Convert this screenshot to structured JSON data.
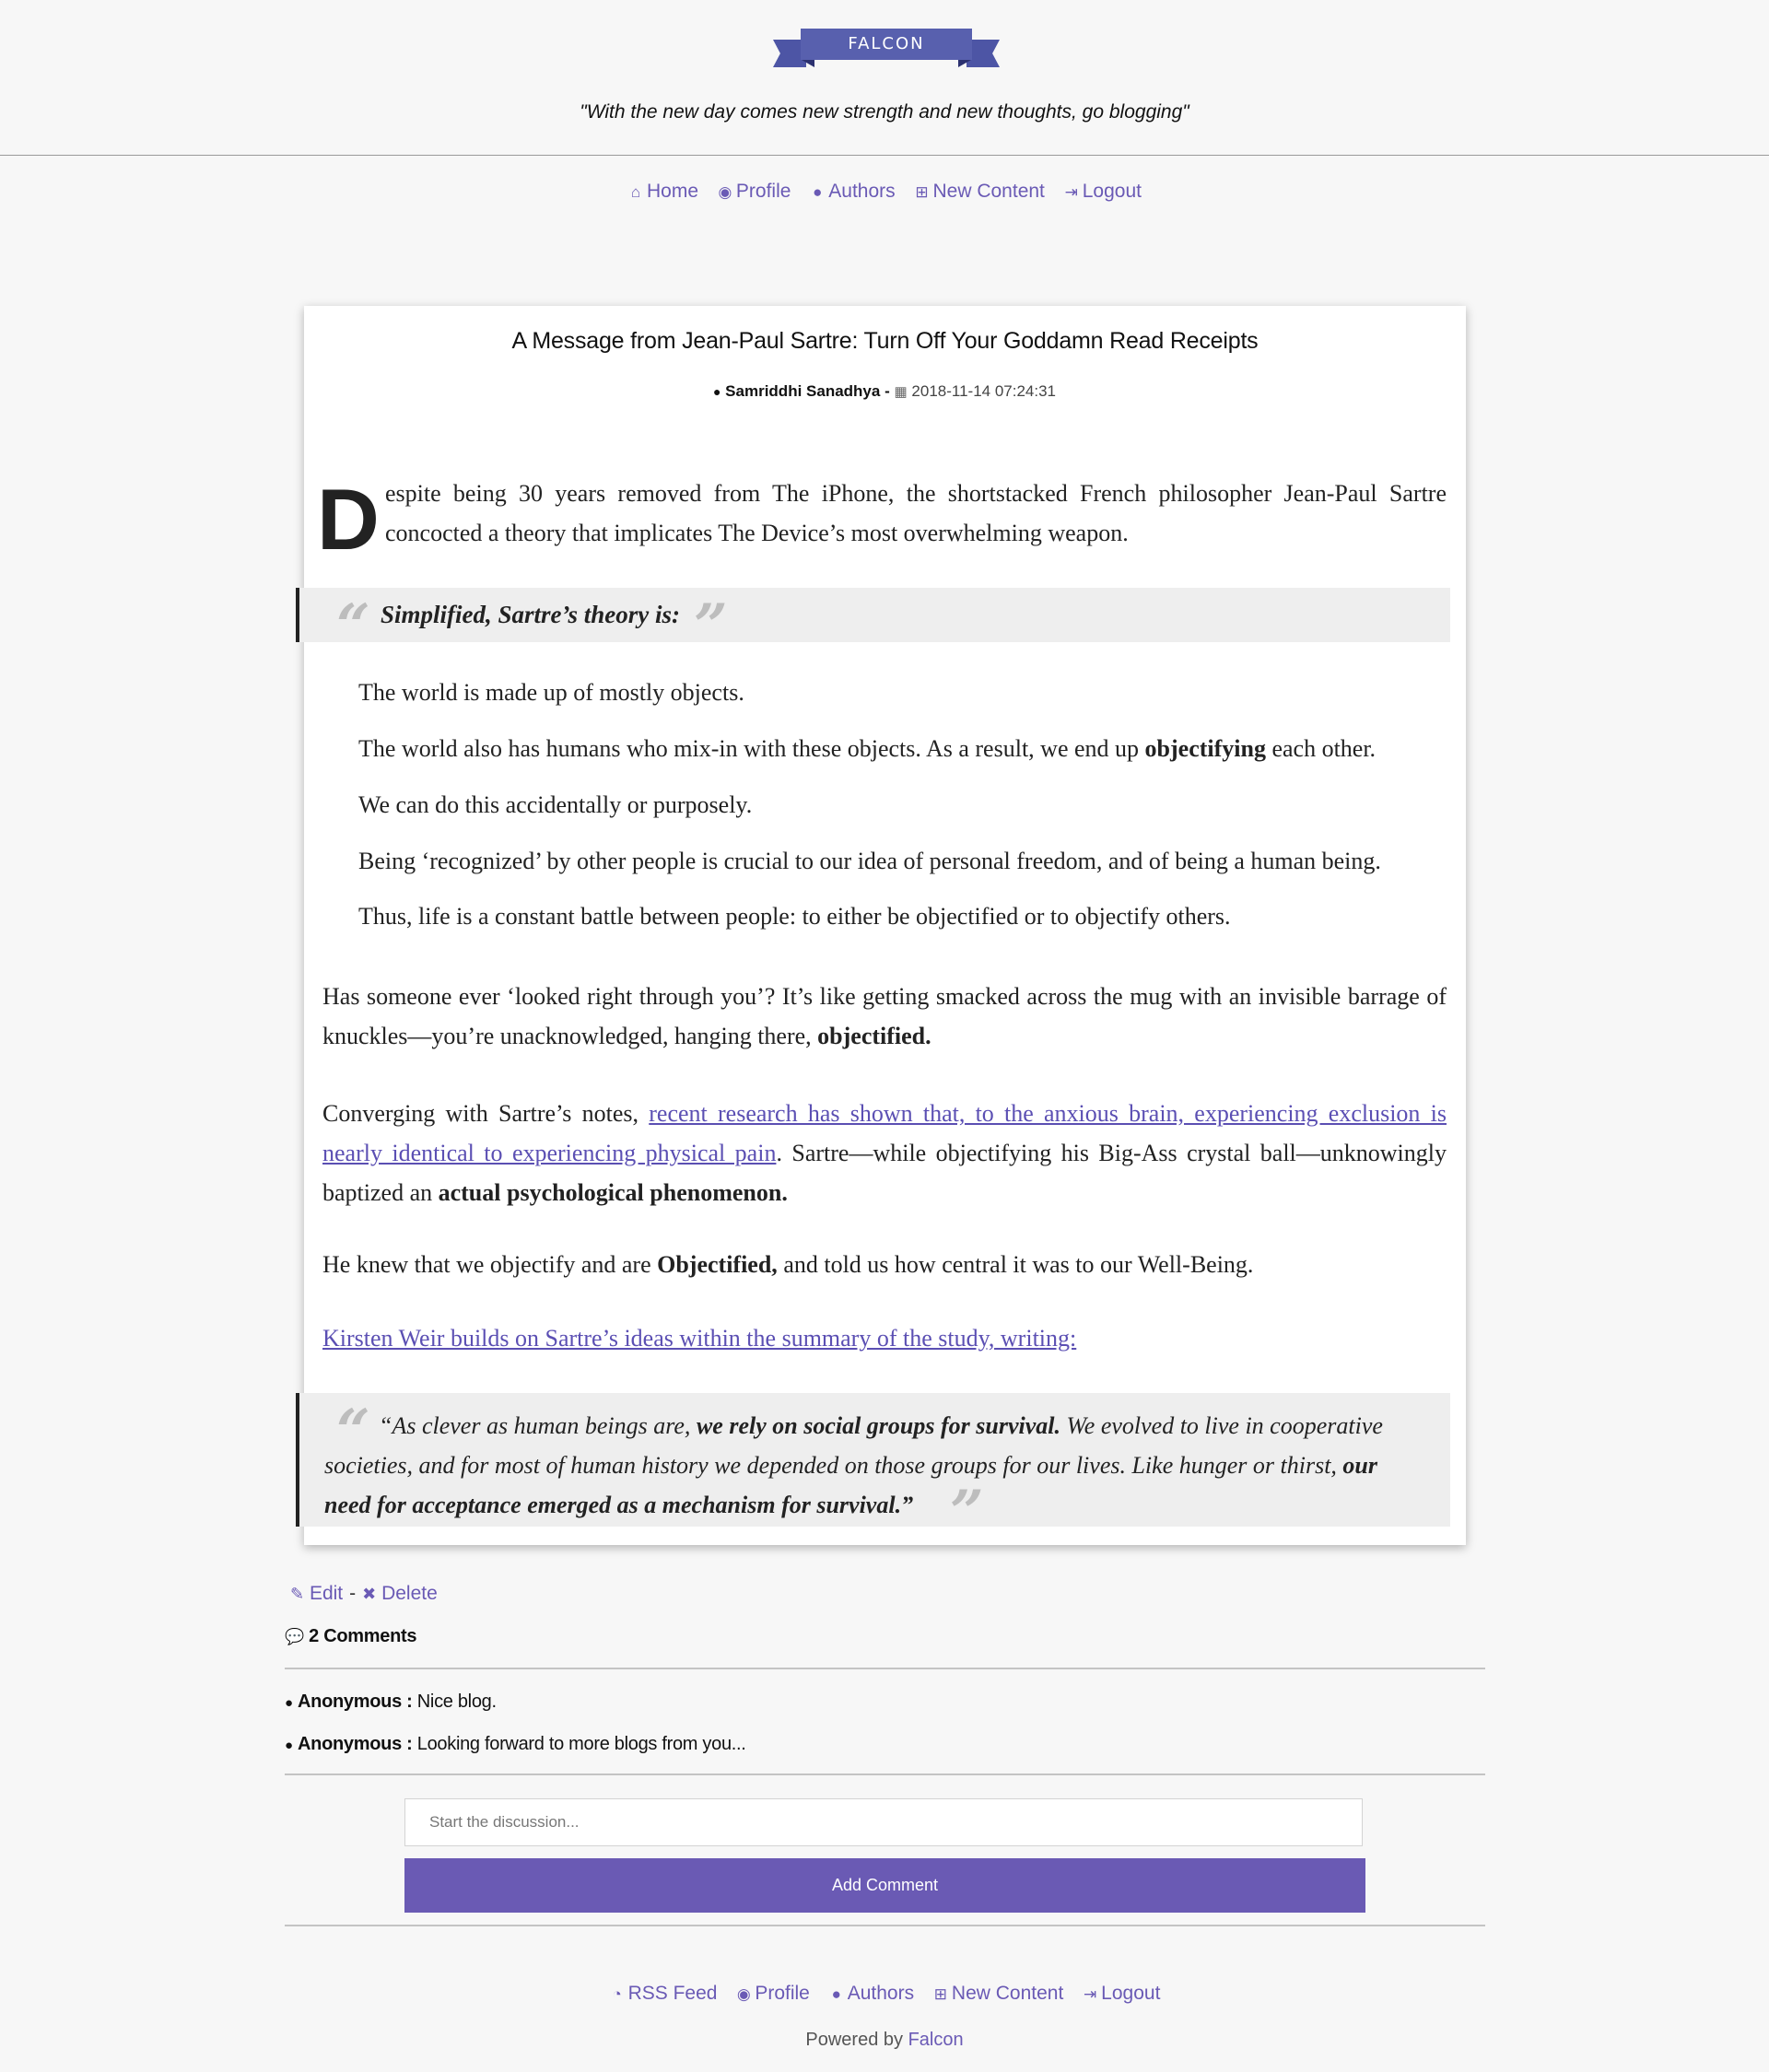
{
  "header": {
    "logo_text": "FALCON",
    "tagline": "\"With the new day comes new strength and new thoughts, go blogging\""
  },
  "nav": [
    {
      "icon": "home-icon",
      "label": "Home"
    },
    {
      "icon": "eye-icon",
      "label": "Profile"
    },
    {
      "icon": "user-icon",
      "label": "Authors"
    },
    {
      "icon": "plus-square-icon",
      "label": "New Content"
    },
    {
      "icon": "sign-out-icon",
      "label": "Logout"
    }
  ],
  "post": {
    "title": "A Message from Jean-Paul Sartre: Turn Off Your Goddamn Read Receipts",
    "author": "Samriddhi Sanadhya",
    "meta_separator": "-",
    "date": "2018-11-14 07:24:31",
    "dropcap": "D",
    "intro": "espite being 30 years removed from The iPhone, the shortstacked French philosopher Jean-Paul Sartre concocted a theory that implicates The Device’s most overwhelming weapon.",
    "quote1": "Simplified, Sartre’s theory is:",
    "list": {
      "l1": "The world is made up of mostly objects.",
      "l2_a": "The world also has humans who mix-in with these objects. As a result, we end up ",
      "l2_b": "objectifying",
      "l2_c": " each other.",
      "l3": "We can do this accidentally or purposely.",
      "l4": "Being ‘recognized’ by other people is crucial to our idea of personal freedom, and of being a human being.",
      "l5": "Thus, life is a constant battle between people: to either be objectified or to objectify others."
    },
    "p1_a": "Has someone ever ‘looked right through you’? It’s like getting smacked across the mug with an invisible barrage of knuckles—you’re unacknowledged, hanging there, ",
    "p1_b": "objectified.",
    "p2_a": "Converging with Sartre’s notes, ",
    "p2_link": "recent research has shown that, to the anxious brain, experiencing exclusion is nearly identical to experiencing physical pain",
    "p2_b": ". Sartre—while objectifying his Big-Ass crystal ball—unknowingly baptized an ",
    "p2_c": "actual psychological phenomenon.",
    "p3_a": "He knew that we objectify and are ",
    "p3_b": "Objectified,",
    "p3_c": " and told us how central it was to our Well-Being.",
    "p4_link": "Kirsten Weir builds on Sartre’s ideas within the summary of the study, writing:",
    "quote2": {
      "a": "“As clever as human beings are, ",
      "b": "we rely on social groups for survival.",
      "c": " We evolved to live in cooperative societies, and for most of human history we depended on those groups for our lives. Like hunger or thirst, ",
      "d": "our need for acceptance emerged as a mechanism for survival.”"
    }
  },
  "actions": {
    "edit": "Edit",
    "separator": "-",
    "delete": "Delete"
  },
  "comments": {
    "heading": "2 Comments",
    "items": [
      {
        "author": "Anonymous :",
        "text": "Nice blog."
      },
      {
        "author": "Anonymous :",
        "text": "Looking forward to more blogs from you..."
      }
    ],
    "input_placeholder": "Start the discussion...",
    "input_value": "",
    "submit_label": "Add Comment"
  },
  "footer": {
    "nav": [
      {
        "icon": "rss-icon",
        "label": "RSS Feed"
      },
      {
        "icon": "eye-icon",
        "label": "Profile"
      },
      {
        "icon": "user-icon",
        "label": "Authors"
      },
      {
        "icon": "plus-square-icon",
        "label": "New Content"
      },
      {
        "icon": "sign-out-icon",
        "label": "Logout"
      }
    ],
    "powered_prefix": "Powered by ",
    "powered_link": "Falcon"
  },
  "colors": {
    "accent": "#6a5ab5",
    "logo": "#5860ae",
    "button": "#6a5ab4",
    "background": "#f7f7f7"
  }
}
